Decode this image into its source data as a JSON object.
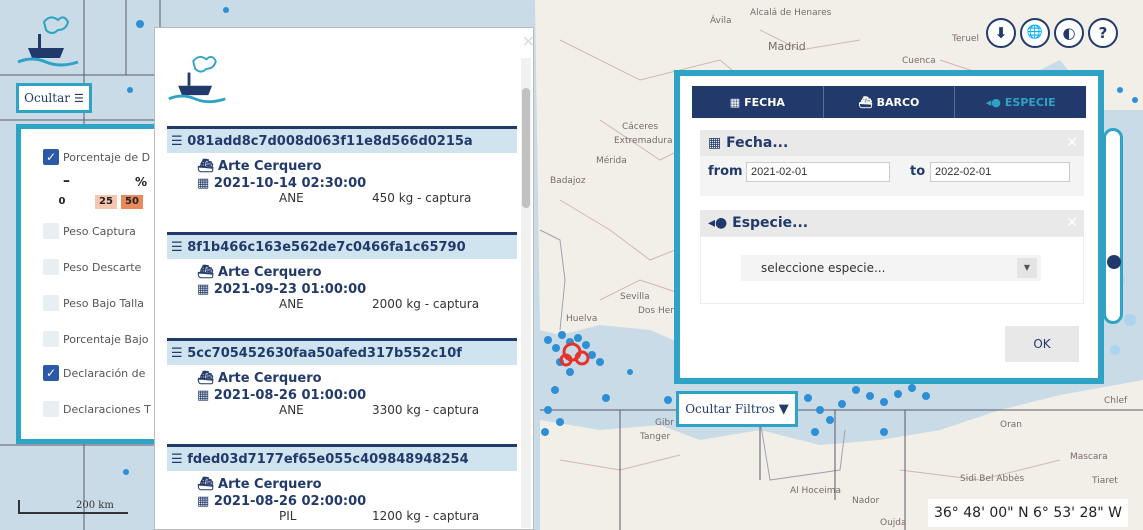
{
  "layer_panel": {
    "ocultar_label": "Ocultar",
    "rows": [
      {
        "label": "Porcentaje de D",
        "checked": true
      },
      {
        "label": "Peso Captura",
        "checked": false
      },
      {
        "label": "Peso Descarte",
        "checked": false
      },
      {
        "label": "Peso Bajo Talla",
        "checked": false
      },
      {
        "label": "Porcentaje Bajo",
        "checked": false
      },
      {
        "label": "Declaración de",
        "checked": true
      },
      {
        "label": "Declaraciones T",
        "checked": false
      }
    ],
    "legend": {
      "minus": "–",
      "percent": "%",
      "values": [
        "0",
        "25",
        "50"
      ]
    }
  },
  "list": {
    "entries": [
      {
        "id": "081add8c7d008d063f11e8d566d0215a",
        "arte": "Arte Cerquero",
        "date": "2021-10-14 02:30:00",
        "species": "ANE",
        "kg": "450 kg - captura"
      },
      {
        "id": "8f1b466c163e562de7c0466fa1c65790",
        "arte": "Arte Cerquero",
        "date": "2021-09-23 01:00:00",
        "species": "ANE",
        "kg": "2000 kg - captura"
      },
      {
        "id": "5cc705452630faa50afed317b552c10f",
        "arte": "Arte Cerquero",
        "date": "2021-08-26 01:00:00",
        "species": "ANE",
        "kg": "3300 kg - captura"
      },
      {
        "id": "fded03d7177ef65e055c409848948254",
        "arte": "Arte Cerquero",
        "date": "2021-08-26 02:00:00",
        "species": "PIL",
        "kg": "1200 kg - captura"
      }
    ]
  },
  "tools": {
    "download": "⬇",
    "globe": "🌐",
    "compass": "◐",
    "help": "?"
  },
  "filter": {
    "tabs": [
      {
        "label": "FECHA",
        "icon": "calendar-icon",
        "active": false
      },
      {
        "label": "BARCO",
        "icon": "ship-icon",
        "active": false
      },
      {
        "label": "ESPECIE",
        "icon": "fish-icon",
        "active": true
      }
    ],
    "fecha_title": "Fecha...",
    "from_label": "from",
    "from_value": "2021-02-01",
    "to_label": "to",
    "to_value": "2022-02-01",
    "especie_title": "Especie...",
    "especie_placeholder": "seleccione especie...",
    "ok_label": "OK"
  },
  "ocultar_filtros_label": "Ocultar Filtros",
  "map": {
    "places": [
      "Ávila",
      "Alcalá de Henares",
      "Madrid",
      "Teruel",
      "Cuenca",
      "Cáceres",
      "Extremadura",
      "Mérida",
      "Badajoz",
      "Sevilla",
      "Dos Hermanas",
      "Huelva",
      "Gibr",
      "Tanger",
      "Al Hoceima",
      "Nador",
      "Oran",
      "Sidi Bel Abbès",
      "Tiaret",
      "Chlef",
      "Oujda",
      "Mascara"
    ],
    "coordinates": "36° 48' 00\" N 6° 53' 28\" W",
    "scale": "200 km",
    "colors": {
      "sea": "#c8dbe6",
      "land": "#f2efe9",
      "accent": "#2ea3c6",
      "navy": "#223a6b",
      "point": "#2d8fd5",
      "point_light": "#a9d3f0",
      "hotspot": "#e6332a"
    }
  }
}
